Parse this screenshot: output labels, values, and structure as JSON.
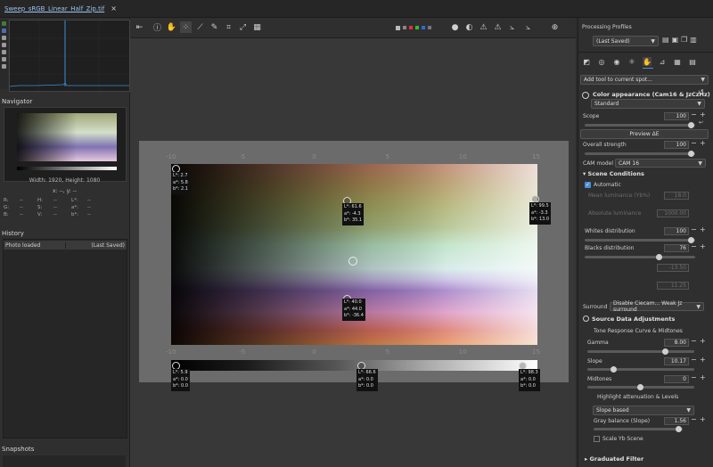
{
  "tab": {
    "filename": "Sweep_sRGB_Linear_Half_Zip.tif",
    "close": "×"
  },
  "navigator": {
    "title": "Navigator",
    "size_info": "Width: 1920, Height: 1080",
    "coords": "x: --, y: --",
    "rgb_rows": [
      [
        "R:",
        "--",
        "H:",
        "--",
        "L*:",
        "--"
      ],
      [
        "G:",
        "--",
        "S:",
        "--",
        "a*:",
        "--"
      ],
      [
        "B:",
        "--",
        "V:",
        "--",
        "b*:",
        "--"
      ]
    ]
  },
  "history": {
    "title": "History",
    "rows": [
      {
        "action": "Photo loaded",
        "profile": "(Last Saved)"
      }
    ]
  },
  "snapshots": {
    "title": "Snapshots"
  },
  "toolbar": {
    "icons": [
      "hand-icon",
      "info-icon",
      "color-picker-icon",
      "wand-icon",
      "pencil-icon",
      "crop-icon",
      "rotate-icon",
      "grid-icon"
    ],
    "right_icons": [
      "focus-icon",
      "warning-icon",
      "warning-icon",
      "graph-icon",
      "graph-icon",
      "crosshair-icon"
    ]
  },
  "image": {
    "top_axis": [
      "-10",
      "-5",
      "0",
      "5",
      "10",
      "15"
    ],
    "bottom_axis": [
      "-10",
      "-5",
      "0",
      "5",
      "10",
      "15"
    ],
    "probes": [
      {
        "L": "L*: 2.7",
        "a": "a*: 5.8",
        "b": "b*: 2.1"
      },
      {
        "L": "L*: 61.6",
        "a": "a*: -4.3",
        "b": "b*: 35.1"
      },
      {
        "L": "L*: 99.5",
        "a": "a*: -3.3",
        "b": "b*: 13.0"
      },
      {
        "L": "L*: 40.0",
        "a": "a*: 44.0",
        "b": "b*: -36.4"
      },
      {
        "L": "L*: 5.9",
        "a": "a*: 0.0",
        "b": "b*: 0.0"
      },
      {
        "L": "L*: 66.6",
        "a": "a*: 0.0",
        "b": "b*: 0.0"
      },
      {
        "L": "L*: 98.3",
        "a": "a*: 0.0",
        "b": "b*: 0.0"
      }
    ]
  },
  "processing": {
    "title": "Processing Profiles",
    "profile_value": "(Last Saved)",
    "add_tool": "Add tool to current spot...",
    "tool_title": "Color appearance (Cam16 & JzCzHz)",
    "mode": "Standard",
    "scope_label": "Scope",
    "scope_value": "100",
    "preview_button": "Preview ΔE",
    "overall_label": "Overall strength",
    "overall_value": "100",
    "cam_label": "CAM model",
    "cam_value": "CAM 16",
    "scene_title": "Scene Conditions",
    "automatic": "Automatic",
    "mean_lum_label": "Mean luminance (Yb%)",
    "mean_lum_value": "18.0",
    "abs_lum_label": "Absolute luminance",
    "abs_lum_value": "1000.00",
    "whites_label": "Whites distribution",
    "whites_value": "100",
    "blacks_label": "Blacks distribution",
    "blacks_value": "76",
    "dim1_value": "-13.50",
    "dim2_value": "11.25",
    "surround_label": "Surround",
    "surround_value": "Disable Ciecam... Weak Jz surround",
    "source_title": "Source Data Adjustments",
    "tone_title": "Tone Response Curve & Midtones",
    "gamma_label": "Gamma",
    "gamma_value": "8.00",
    "slope_label": "Slope",
    "slope_value": "10.17",
    "mid_label": "Midtones",
    "mid_value": "0",
    "highlight_title": "Highlight attenuation & Levels",
    "slope_based": "Slope based",
    "gray_label": "Gray balance (Slope)",
    "gray_value": "1.56",
    "scale_yb": "Scale Yb Scene",
    "grad_title": "Graduated Filter"
  },
  "colors": {
    "accent": "#4a8ed8",
    "panel": "#2f2f2f",
    "canvas": "#383838"
  }
}
